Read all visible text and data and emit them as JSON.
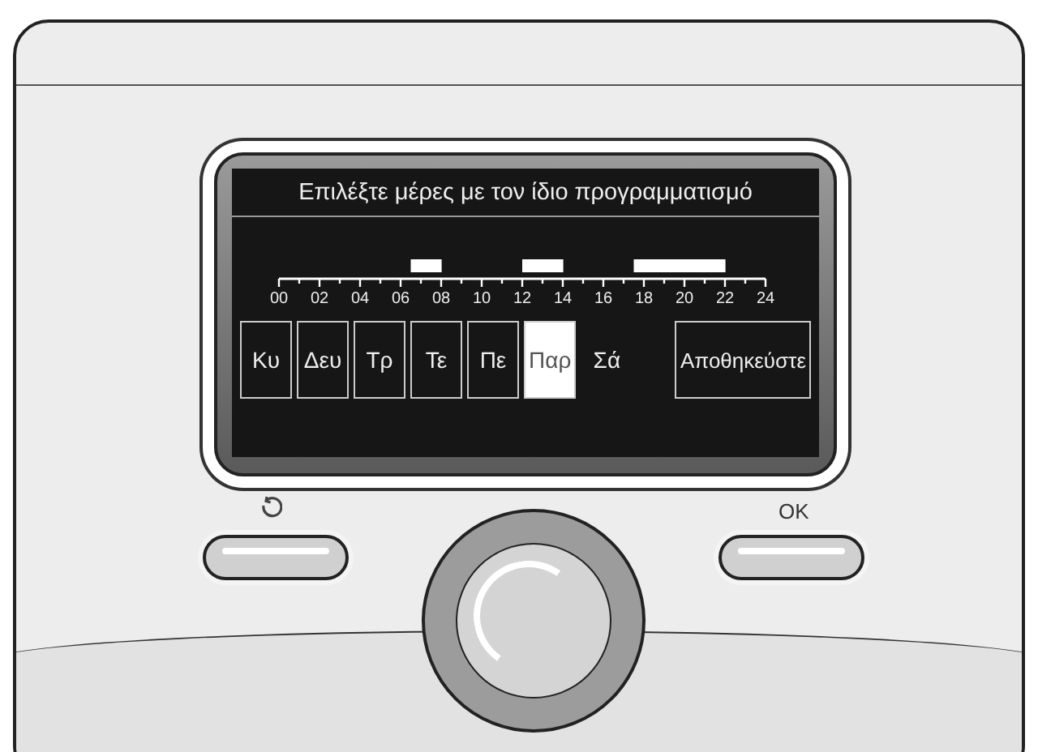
{
  "screen": {
    "title": "Επιλέξτε μέρες με τον ίδιο προγραμματισμό",
    "schedule": {
      "hour_labels": [
        "00",
        "02",
        "04",
        "06",
        "08",
        "10",
        "12",
        "14",
        "16",
        "18",
        "20",
        "22",
        "24"
      ],
      "half_hour_slots": [
        {
          "on": false
        },
        {
          "on": false
        },
        {
          "on": false
        },
        {
          "on": false
        },
        {
          "on": false
        },
        {
          "on": false
        },
        {
          "on": false
        },
        {
          "on": false
        },
        {
          "on": false
        },
        {
          "on": false
        },
        {
          "on": false
        },
        {
          "on": false
        },
        {
          "on": false
        },
        {
          "on": true
        },
        {
          "on": true
        },
        {
          "on": true
        },
        {
          "on": false
        },
        {
          "on": false
        },
        {
          "on": false
        },
        {
          "on": false
        },
        {
          "on": false
        },
        {
          "on": false
        },
        {
          "on": false
        },
        {
          "on": false
        },
        {
          "on": true
        },
        {
          "on": true
        },
        {
          "on": true
        },
        {
          "on": true
        },
        {
          "on": false
        },
        {
          "on": false
        },
        {
          "on": false
        },
        {
          "on": false
        },
        {
          "on": false
        },
        {
          "on": false
        },
        {
          "on": false
        },
        {
          "on": true
        },
        {
          "on": true
        },
        {
          "on": true
        },
        {
          "on": true
        },
        {
          "on": true
        },
        {
          "on": true
        },
        {
          "on": true
        },
        {
          "on": true
        },
        {
          "on": true
        },
        {
          "on": false
        },
        {
          "on": false
        },
        {
          "on": false
        },
        {
          "on": false
        }
      ]
    },
    "days": [
      {
        "label": "Κυ",
        "kind": "boxed",
        "selected": false
      },
      {
        "label": "Δευ",
        "kind": "boxed",
        "selected": false
      },
      {
        "label": "Τρ",
        "kind": "boxed",
        "selected": false
      },
      {
        "label": "Τε",
        "kind": "boxed",
        "selected": false
      },
      {
        "label": "Πε",
        "kind": "boxed",
        "selected": false
      },
      {
        "label": "Παρ",
        "kind": "boxed",
        "selected": true
      },
      {
        "label": "Σά",
        "kind": "plain",
        "selected": false
      }
    ],
    "save_button": "Αποθηκεύστε"
  },
  "keys": {
    "ok_label": "OK"
  }
}
